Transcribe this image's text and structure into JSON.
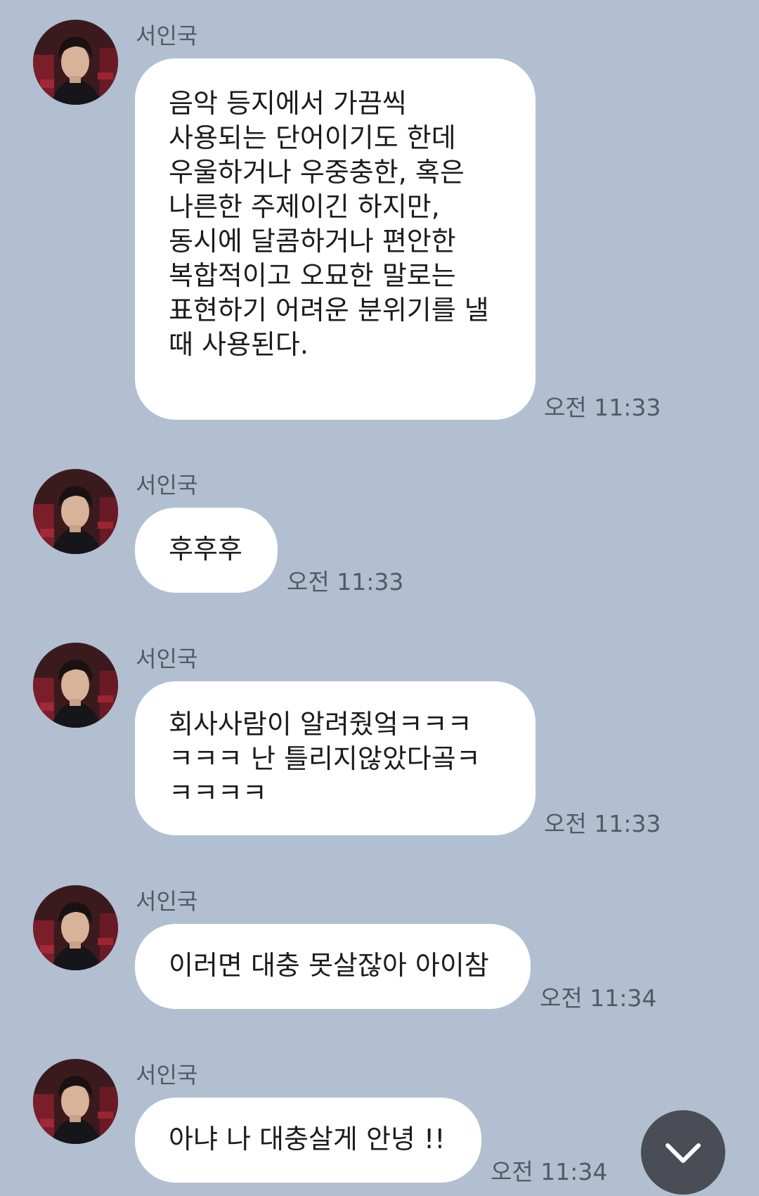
{
  "messages": [
    {
      "sender": "서인국",
      "text": "음악 등지에서 가끔씩\n사용되는 단어이기도 한데\n우울하거나 우중충한, 혹은\n나른한 주제이긴 하지만,\n동시에 달콤하거나 편안한\n복합적이고 오묘한 말로는\n표현하기 어려운 분위기를 낼\n때 사용된다.",
      "time": "오전 11:33"
    },
    {
      "sender": "서인국",
      "text": "후후후",
      "time": "오전 11:33"
    },
    {
      "sender": "서인국",
      "text": "회사사람이 알려줬엌ㅋㅋㅋ\nㅋㅋㅋ 난 틀리지않았다곸ㅋ\nㅋㅋㅋㅋ",
      "time": "오전 11:33"
    },
    {
      "sender": "서인국",
      "text": "이러면 대충 못살잖아 아이참",
      "time": "오전 11:34"
    },
    {
      "sender": "서인국",
      "text": "아냐 나 대충살게 안녕 !!",
      "time": "오전 11:34"
    }
  ],
  "scroll_button": {
    "icon": "chevron-down-icon"
  }
}
